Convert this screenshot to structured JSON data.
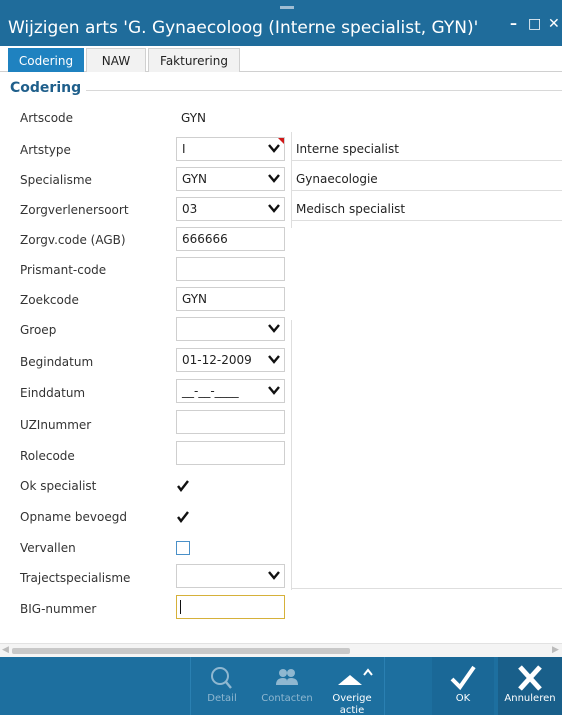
{
  "window": {
    "title": "Wijzigen arts 'G. Gynaecoloog (Interne specialist, GYN)'",
    "minimize": "–",
    "maximize": "□",
    "close": "✕"
  },
  "tabs": [
    {
      "label": "Codering",
      "active": true
    },
    {
      "label": "NAW",
      "active": false
    },
    {
      "label": "Fakturering",
      "active": false
    }
  ],
  "section": {
    "title": "Codering"
  },
  "fields": {
    "artscode": {
      "label": "Artscode",
      "value": "GYN"
    },
    "artstype": {
      "label": "Artstype",
      "value": "I",
      "description": "Interne specialist"
    },
    "specialisme": {
      "label": "Specialisme",
      "value": "GYN",
      "description": "Gynaecologie"
    },
    "zorgverlenersoort": {
      "label": "Zorgverlenersoort",
      "value": "03",
      "description": "Medisch specialist"
    },
    "zorgv_code": {
      "label": "Zorgv.code (AGB)",
      "value": "666666"
    },
    "prismant_code": {
      "label": "Prismant-code",
      "value": ""
    },
    "zoekcode": {
      "label": "Zoekcode",
      "value": "GYN"
    },
    "groep": {
      "label": "Groep",
      "value": ""
    },
    "begindatum": {
      "label": "Begindatum",
      "value": "01-12-2009"
    },
    "einddatum": {
      "label": "Einddatum",
      "value": "__-__-____"
    },
    "uzinummer": {
      "label": "UZInummer",
      "value": ""
    },
    "rolecode": {
      "label": "Rolecode",
      "value": ""
    },
    "ok_specialist": {
      "label": "Ok specialist",
      "checked": true
    },
    "opname_bevoegd": {
      "label": "Opname bevoegd",
      "checked": true
    },
    "vervallen": {
      "label": "Vervallen",
      "checked": false
    },
    "trajectspecialisme": {
      "label": "Trajectspecialisme",
      "value": ""
    },
    "big_nummer": {
      "label": "BIG-nummer",
      "value": ""
    }
  },
  "toolbar": {
    "detail": {
      "label": "Detail",
      "icon": "search-icon",
      "enabled": false
    },
    "contacten": {
      "label": "Contacten",
      "icon": "people-icon",
      "enabled": false
    },
    "overige": {
      "label": "Overige actie",
      "icon": "arrow-up-icon",
      "enabled": true
    },
    "ok": {
      "label": "OK",
      "icon": "checkmark-icon"
    },
    "annuleren": {
      "label": "Annuleren",
      "icon": "x-icon"
    }
  },
  "colors": {
    "titlebar": "#1f6c9b",
    "active_tab": "#1f82c0",
    "toolbar": "#1d6f9f",
    "section_title": "#1f5f8b",
    "focus_border": "#d6b13a"
  }
}
